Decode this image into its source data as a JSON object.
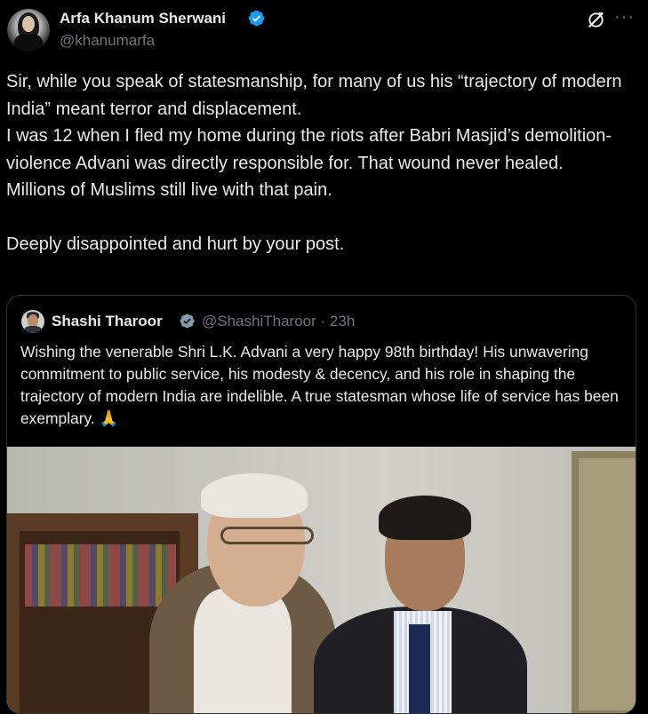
{
  "tweet": {
    "author_name": "Arfa Khanum Sherwani",
    "author_handle": "@khanumarfa",
    "text": "Sir, while you speak of statesmanship, for many of us his “trajectory of modern India” meant terror and displacement.\nI was 12 when I fled my home during the riots after Babri Masjid’s demolition-violence Advani was directly responsible for. That wound never healed.\nMillions of Muslims still live with that pain.\n\nDeeply disappointed and hurt by your post.",
    "more_icon": "···"
  },
  "quote": {
    "author_name": "Shashi Tharoor",
    "author_handle": "@ShashiTharoor",
    "separator": "·",
    "time": "23h",
    "text": "Wishing the venerable Shri L.K. Advani a very happy 98th birthday! His unwavering commitment to public service, his modesty & decency, and his role in shaping the trajectory of modern India are indelible. A true statesman whose life of service has been exemplary. 🙏"
  },
  "colors": {
    "background": "#000000",
    "text": "#e7e9ea",
    "secondary": "#71767b",
    "verified": "#1d9bf0",
    "border": "#2f3336"
  },
  "icons": [
    "verified-badge-icon",
    "grok-icon",
    "more-icon"
  ]
}
